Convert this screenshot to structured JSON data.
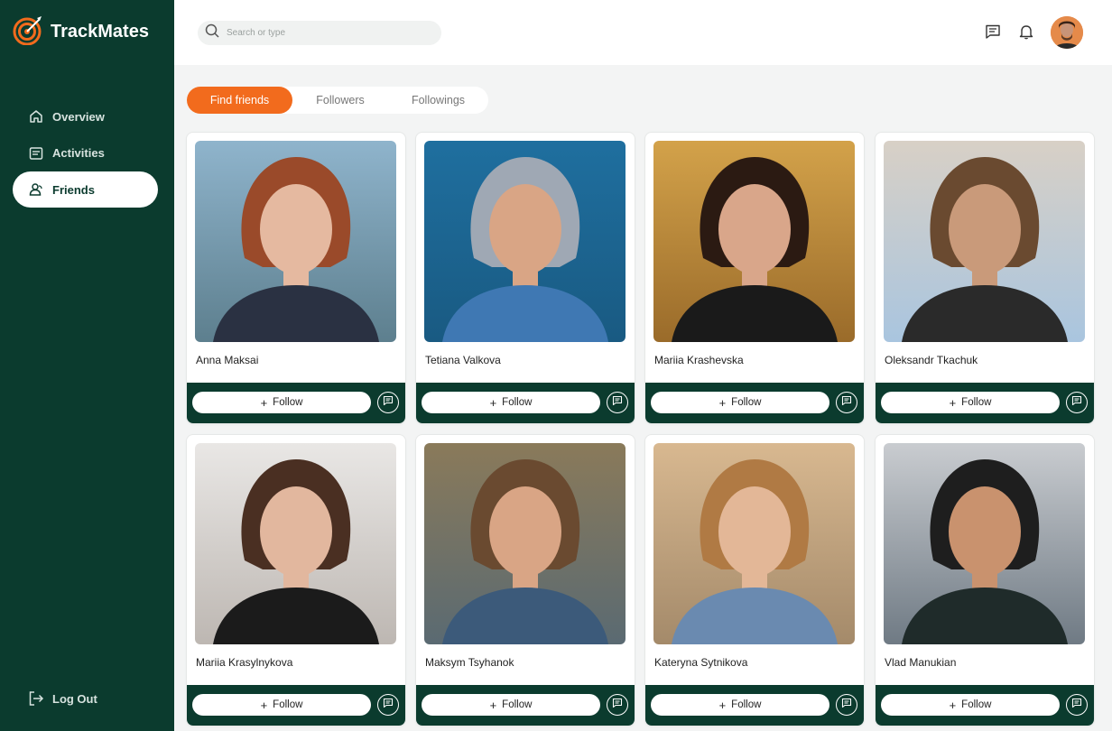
{
  "app": {
    "name": "TrackMates"
  },
  "sidebar": {
    "items": [
      {
        "label": "Overview",
        "icon": "home-icon"
      },
      {
        "label": "Activities",
        "icon": "list-icon"
      },
      {
        "label": "Friends",
        "icon": "friends-icon",
        "active": true
      }
    ],
    "logout_label": "Log Out"
  },
  "header": {
    "search_placeholder": "Search or type"
  },
  "tabs": [
    {
      "label": "Find friends",
      "active": true
    },
    {
      "label": "Followers"
    },
    {
      "label": "Followings"
    }
  ],
  "follow_label": "Follow",
  "people": [
    {
      "name": "Anna Maksai"
    },
    {
      "name": "Tetiana Valkova"
    },
    {
      "name": "Mariia Krashevska"
    },
    {
      "name": "Oleksandr Tkachuk"
    },
    {
      "name": "Mariia Krasylnykova"
    },
    {
      "name": "Maksym Tsyhanok"
    },
    {
      "name": "Kateryna Sytnikova"
    },
    {
      "name": "Vlad Manukian"
    }
  ],
  "colors": {
    "sidebar": "#0b3b2e",
    "accent": "#f26b1d",
    "background": "#f3f4f4"
  }
}
